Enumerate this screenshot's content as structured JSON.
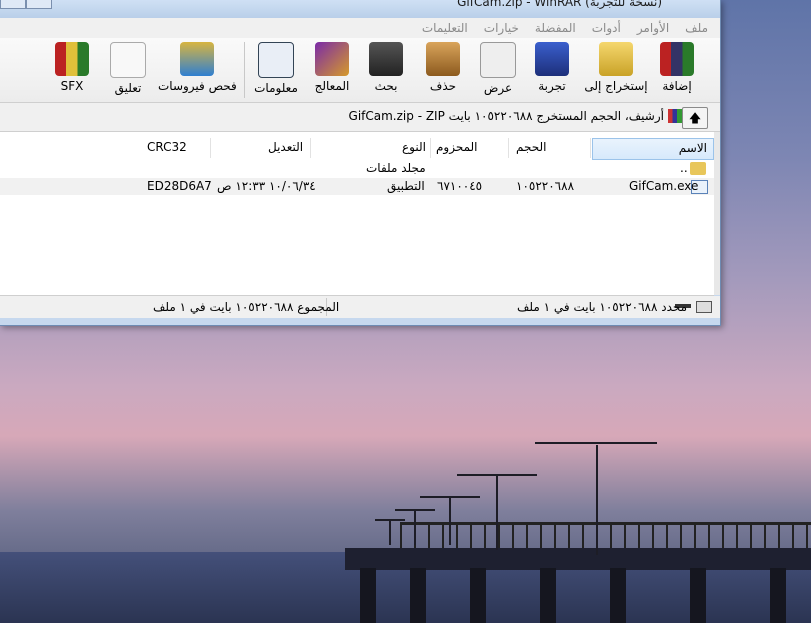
{
  "window": {
    "title": "GifCam.zip - WinRAR (نسخة للتجربة)"
  },
  "menu": [
    "ملف",
    "الأوامر",
    "أدوات",
    "المفضلة",
    "خيارات",
    "التعليمات"
  ],
  "toolbar": [
    {
      "label": "إضافة",
      "icon": "add-archive-icon"
    },
    {
      "label": "إستخراج إلى",
      "icon": "extract-to-icon"
    },
    {
      "label": "تجربة",
      "icon": "test-icon"
    },
    {
      "label": "عرض",
      "icon": "view-icon"
    },
    {
      "label": "حذف",
      "icon": "delete-icon"
    },
    {
      "label": "بحث",
      "icon": "find-icon"
    },
    {
      "label": "المعالج",
      "icon": "wizard-icon"
    },
    {
      "label": "معلومات",
      "icon": "info-icon"
    },
    {
      "label": "فحص فيروسات",
      "icon": "virus-scan-icon"
    },
    {
      "label": "تعليق",
      "icon": "comment-icon"
    },
    {
      "label": "SFX",
      "icon": "sfx-icon"
    }
  ],
  "address": {
    "path": "GifCam.zip - ZIP أرشيف، الحجم المستخرج ١٠٥٢٢٠٦٨٨ بايت"
  },
  "columns": {
    "name": "الاسم",
    "size": "الحجم",
    "packed": "المحزوم",
    "type": "النوع",
    "modified": "التعديل",
    "crc": "CRC32"
  },
  "files": [
    {
      "name": "..",
      "size": "",
      "packed": "",
      "type": "مجلد ملفات",
      "modified": "",
      "crc": ""
    },
    {
      "name": "GifCam.exe",
      "size": "١٠٥٢٢٠٦٨٨",
      "packed": "٦٧١٠٠٤٥",
      "type": "التطبيق",
      "modified": "١٠/٠٦/٣٤ ١٢:٣٣ ص",
      "crc": "ED28D6A7"
    }
  ],
  "status": {
    "selected": "محدد ١٠٥٢٢٠٦٨٨ بايت في ١ ملف",
    "total": "المجموع ١٠٥٢٢٠٦٨٨ بايت في ١ ملف"
  }
}
